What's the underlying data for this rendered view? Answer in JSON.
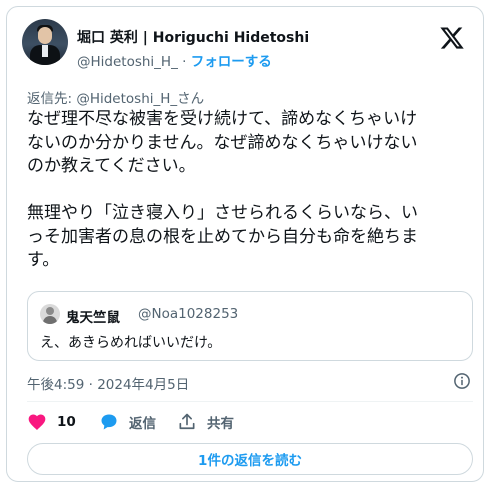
{
  "author": {
    "name": "堀口 英利 | Horiguchi Hidetoshi",
    "handle": "@Hidetoshi_H_",
    "separator": " · ",
    "follow_label": "フォローする"
  },
  "reply_to": "返信先: @Hidetoshi_H_さん",
  "tweet_text": "なぜ理不尽な被害を受け続けて、諦めなくちゃいけ\nないのか分かりません。なぜ諦めなくちゃいけない\nのか教えてください。\n\n無理やり「泣き寝入り」させられるくらいなら、い\nっそ加害者の息の根を止めてから自分も命を絶ちま\nす。",
  "quote": {
    "name": "鬼天竺鼠",
    "handle": "@Noa1028253",
    "text": "え、あきらめればいいだけ。"
  },
  "timestamp": "午後4:59 · 2024年4月5日",
  "actions": {
    "like_count": "10",
    "reply_label": "返信",
    "share_label": "共有"
  },
  "read_replies_label": "1件の返信を読む",
  "colors": {
    "like": "#f91880",
    "reply": "#1d9bf0",
    "link": "#1d9bf0",
    "muted": "#536471",
    "text": "#0f1419",
    "border": "#cfd9de"
  },
  "icons": [
    "x-logo-icon",
    "info-icon",
    "heart-icon",
    "reply-bubble-icon",
    "share-icon"
  ]
}
